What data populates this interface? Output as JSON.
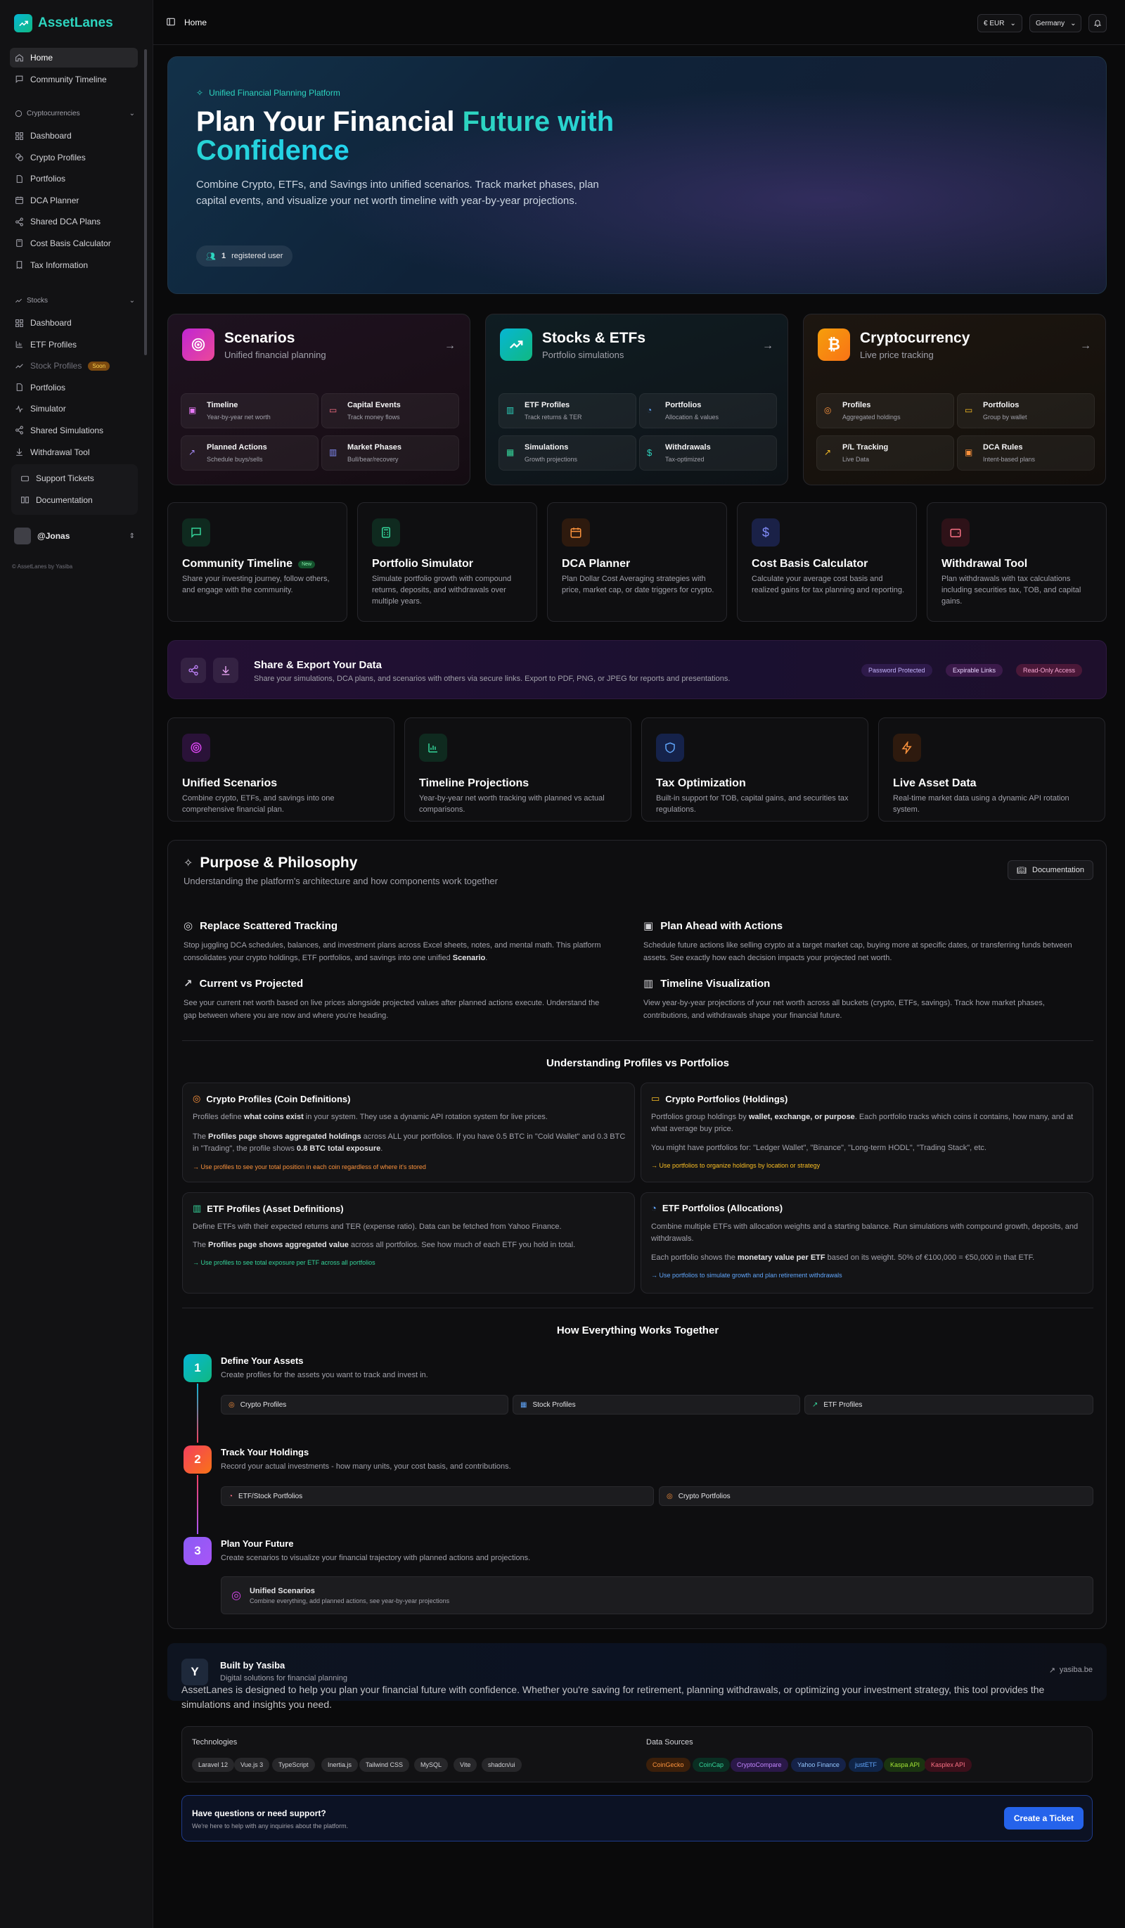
{
  "app": {
    "name": "AssetLanes",
    "copyright": "© AssetLanes by Yasiba"
  },
  "topbar": {
    "page": "Home",
    "currency": "€ EUR",
    "country": "Germany"
  },
  "sidebar": {
    "top": [
      {
        "label": "Home"
      },
      {
        "label": "Community Timeline"
      }
    ],
    "crypto_head": "Cryptocurrencies",
    "crypto": [
      {
        "label": "Dashboard"
      },
      {
        "label": "Crypto Profiles"
      },
      {
        "label": "Portfolios"
      },
      {
        "label": "DCA Planner"
      },
      {
        "label": "Shared DCA Plans"
      },
      {
        "label": "Cost Basis Calculator"
      },
      {
        "label": "Tax Information"
      }
    ],
    "stocks_head": "Stocks",
    "stocks": [
      {
        "label": "Dashboard"
      },
      {
        "label": "ETF Profiles"
      },
      {
        "label": "Stock Profiles",
        "badge": "Soon"
      },
      {
        "label": "Portfolios"
      },
      {
        "label": "Simulator"
      },
      {
        "label": "Shared Simulations"
      },
      {
        "label": "Withdrawal Tool"
      }
    ],
    "support": [
      {
        "label": "Support Tickets"
      },
      {
        "label": "Documentation"
      }
    ],
    "user": "@Jonas"
  },
  "hero": {
    "tag": "Unified Financial Planning Platform",
    "title_a": "Plan Your Financial ",
    "title_b": "Future with Confidence",
    "subtitle": "Combine Crypto, ETFs, and Savings into unified scenarios. Track market phases, plan capital events, and visualize your net worth timeline with year-by-year projections.",
    "user_count": "1",
    "user_label": "registered user"
  },
  "cards": [
    {
      "title": "Scenarios",
      "subtitle": "Unified financial planning",
      "tiles": [
        {
          "t": "Timeline",
          "s": "Year-by-year net worth"
        },
        {
          "t": "Capital Events",
          "s": "Track money flows"
        },
        {
          "t": "Planned Actions",
          "s": "Schedule buys/sells"
        },
        {
          "t": "Market Phases",
          "s": "Bull/bear/recovery"
        }
      ]
    },
    {
      "title": "Stocks & ETFs",
      "subtitle": "Portfolio simulations",
      "tiles": [
        {
          "t": "ETF Profiles",
          "s": "Track returns & TER"
        },
        {
          "t": "Portfolios",
          "s": "Allocation & values"
        },
        {
          "t": "Simulations",
          "s": "Growth projections"
        },
        {
          "t": "Withdrawals",
          "s": "Tax-optimized"
        }
      ]
    },
    {
      "title": "Cryptocurrency",
      "subtitle": "Live price tracking",
      "tiles": [
        {
          "t": "Profiles",
          "s": "Aggregated holdings"
        },
        {
          "t": "Portfolios",
          "s": "Group by wallet"
        },
        {
          "t": "P/L Tracking",
          "s": "Live Data"
        },
        {
          "t": "DCA Rules",
          "s": "Intent-based plans"
        }
      ]
    }
  ],
  "tools": [
    {
      "title": "Community Timeline",
      "badge": "New",
      "desc": "Share your investing journey, follow others, and engage with the community."
    },
    {
      "title": "Portfolio Simulator",
      "desc": "Simulate portfolio growth with compound returns, deposits, and withdrawals over multiple years."
    },
    {
      "title": "DCA Planner",
      "desc": "Plan Dollar Cost Averaging strategies with price, market cap, or date triggers for crypto."
    },
    {
      "title": "Cost Basis Calculator",
      "desc": "Calculate your average cost basis and realized gains for tax planning and reporting."
    },
    {
      "title": "Withdrawal Tool",
      "desc": "Plan withdrawals with tax calculations including securities tax, TOB, and capital gains."
    }
  ],
  "share": {
    "title": "Share & Export Your Data",
    "desc": "Share your simulations, DCA plans, and scenarios with others via secure links. Export to PDF, PNG, or JPEG for reports and presentations.",
    "chips": [
      "Password Protected",
      "Expirable Links",
      "Read-Only Access"
    ]
  },
  "features": [
    {
      "title": "Unified Scenarios",
      "desc": "Combine crypto, ETFs, and savings into one comprehensive financial plan."
    },
    {
      "title": "Timeline Projections",
      "desc": "Year-by-year net worth tracking with planned vs actual comparisons."
    },
    {
      "title": "Tax Optimization",
      "desc": "Built-in support for TOB, capital gains, and securities tax regulations."
    },
    {
      "title": "Live Asset Data",
      "desc": "Real-time market data using a dynamic API rotation system."
    }
  ],
  "purpose": {
    "title": "Purpose & Philosophy",
    "subtitle": "Understanding the platform's architecture and how components work together",
    "doc_btn": "Documentation",
    "points": [
      {
        "title": "Replace Scattered Tracking",
        "desc_a": "Stop juggling DCA schedules, balances, and investment plans across Excel sheets, notes, and mental math. This platform consolidates your crypto holdings, ETF portfolios, and savings into one unified ",
        "desc_b": "Scenario",
        "desc_c": "."
      },
      {
        "title": "Plan Ahead with Actions",
        "desc": "Schedule future actions like selling crypto at a target market cap, buying more at specific dates, or transferring funds between assets. See exactly how each decision impacts your projected net worth."
      },
      {
        "title": "Current vs Projected",
        "desc": "See your current net worth based on live prices alongside projected values after planned actions execute. Understand the gap between where you are now and where you're heading."
      },
      {
        "title": "Timeline Visualization",
        "desc": "View year-by-year projections of your net worth across all buckets (crypto, ETFs, savings). Track how market phases, contributions, and withdrawals shape your financial future."
      }
    ],
    "pvp_title": "Understanding Profiles vs Portfolios",
    "pvp": [
      {
        "title": "Crypto Profiles (Coin Definitions)",
        "p1a": "Profiles define ",
        "p1b": "what coins exist",
        "p1c": " in your system. They use a dynamic API rotation system for live prices.",
        "p2a": "The ",
        "p2b": "Profiles page shows aggregated holdings",
        "p2c": " across ALL your portfolios. If you have 0.5 BTC in \"Cold Wallet\" and 0.3 BTC in \"Trading\", the profile shows ",
        "p2d": "0.8 BTC total exposure",
        "p2e": ".",
        "link": "→ Use profiles to see your total position in each coin regardless of where it's stored"
      },
      {
        "title": "Crypto Portfolios (Holdings)",
        "p1a": "Portfolios group holdings by ",
        "p1b": "wallet, exchange, or purpose",
        "p1c": ". Each portfolio tracks which coins it contains, how many, and at what average buy price.",
        "p2a": "You might have portfolios for: \"Ledger Wallet\", \"Binance\", \"Long-term HODL\", \"Trading Stack\", etc.",
        "link": "→ Use portfolios to organize holdings by location or strategy"
      },
      {
        "title": "ETF Profiles (Asset Definitions)",
        "p1a": "Define ETFs with their expected returns and TER (expense ratio). Data can be fetched from Yahoo Finance.",
        "p2a": "The ",
        "p2b": "Profiles page shows aggregated value",
        "p2c": " across all portfolios. See how much of each ETF you hold in total.",
        "link": "→ Use profiles to see total exposure per ETF across all portfolios"
      },
      {
        "title": "ETF Portfolios (Allocations)",
        "p1a": "Combine multiple ETFs with allocation weights and a starting balance. Run simulations with compound growth, deposits, and withdrawals.",
        "p2a": "Each portfolio shows the ",
        "p2b": "monetary value per ETF",
        "p2c": " based on its weight. 50% of €100,000 = €50,000 in that ETF.",
        "link": "→ Use portfolios to simulate growth and plan retirement withdrawals"
      }
    ],
    "how_title": "How Everything Works Together",
    "steps": [
      {
        "n": "1",
        "title": "Define Your Assets",
        "desc": "Create profiles for the assets you want to track and invest in.",
        "chips": [
          "Crypto Profiles",
          "Stock Profiles",
          "ETF Profiles"
        ]
      },
      {
        "n": "2",
        "title": "Track Your Holdings",
        "desc": "Record your actual investments - how many units, your cost basis, and contributions.",
        "chips": [
          "ETF/Stock Portfolios",
          "Crypto Portfolios"
        ]
      },
      {
        "n": "3",
        "title": "Plan Your Future",
        "desc": "Create scenarios to visualize your financial trajectory with planned actions and projections.",
        "chip_title": "Unified Scenarios",
        "chip_sub": "Combine everything, add planned actions, see year-by-year projections"
      }
    ]
  },
  "built": {
    "initial": "Y",
    "title": "Built by Yasiba",
    "subtitle": "Digital solutions for financial planning",
    "link": "yasiba.be"
  },
  "about": "AssetLanes is designed to help you plan your financial future with confidence. Whether you're saving for retirement, planning withdrawals, or optimizing your investment strategy, this tool provides the simulations and insights you need.",
  "tech": {
    "label": "Technologies",
    "items": [
      "Laravel 12",
      "Vue.js 3",
      "TypeScript",
      "Inertia.js",
      "Tailwind CSS",
      "MySQL",
      "Vite",
      "shadcn/ui"
    ],
    "ds_label": "Data Sources",
    "sources": [
      "CoinGecko",
      "CoinCap",
      "CryptoCompare",
      "Yahoo Finance",
      "justETF",
      "Kaspa API",
      "Kasplex API"
    ]
  },
  "support": {
    "title": "Have questions or need support?",
    "desc": "We're here to help with any inquiries about the platform.",
    "button": "Create a Ticket"
  }
}
